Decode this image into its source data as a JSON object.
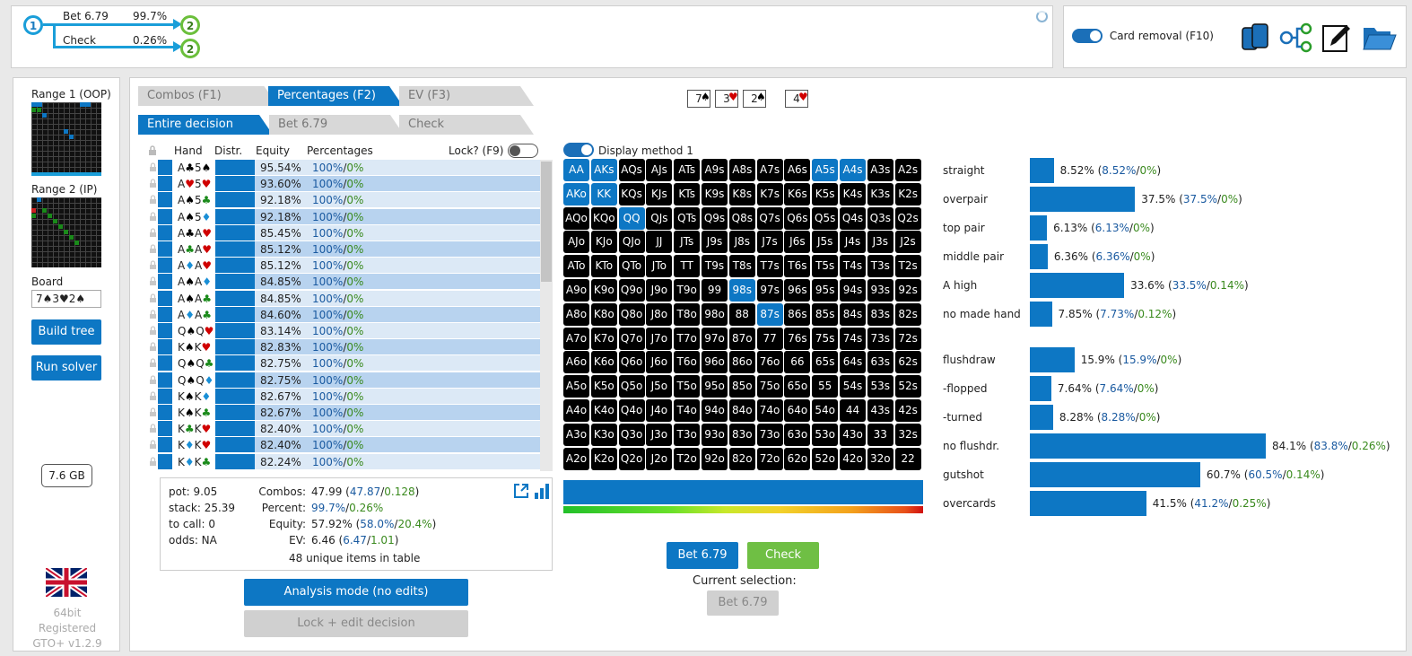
{
  "tree": {
    "root": "1",
    "actions": [
      {
        "label": "Bet 6.79",
        "pct": "99.7%",
        "node": "2"
      },
      {
        "label": "Check",
        "pct": "0.26%",
        "node": "2"
      }
    ]
  },
  "topbar": {
    "card_removal": "Card removal (F10)"
  },
  "sidebar": {
    "range1": "Range 1 (OOP)",
    "range2": "Range 2 (IP)",
    "board_label": "Board",
    "board_value": "7♠3♥2♠",
    "build_tree": "Build tree",
    "run_solver": "Run solver",
    "memory": "7.6 GB",
    "info1": "64bit",
    "info2": "Registered",
    "info3": "GTO+ v1.2.9"
  },
  "tabs": {
    "row1": [
      "Combos (F1)",
      "Percentages (F2)",
      "EV (F3)"
    ],
    "row2": [
      "Entire decision",
      "Bet 6.79",
      "Check"
    ]
  },
  "board_cards": [
    {
      "rank": "7",
      "suit": "♠",
      "color": "#000"
    },
    {
      "rank": "3",
      "suit": "♥",
      "color": "#d00000"
    },
    {
      "rank": "2",
      "suit": "♠",
      "color": "#000"
    },
    {
      "rank": "4",
      "suit": "♥",
      "color": "#d00000"
    }
  ],
  "table": {
    "headers": {
      "hand": "Hand",
      "distr": "Distr.",
      "equity": "Equity",
      "percentages": "Percentages",
      "lock": "Lock? (F9)"
    },
    "rows": [
      {
        "r1": "A",
        "s1": "♣",
        "c1": "#000",
        "r2": "5",
        "s2": "♠",
        "c2": "#000",
        "eq": "95.54%",
        "p1": "100%",
        "p2": "0%"
      },
      {
        "r1": "A",
        "s1": "♥",
        "c1": "#d00000",
        "r2": "5",
        "s2": "♥",
        "c2": "#d00000",
        "eq": "93.60%",
        "p1": "100%",
        "p2": "0%"
      },
      {
        "r1": "A",
        "s1": "♠",
        "c1": "#000",
        "r2": "5",
        "s2": "♣",
        "c2": "#1a8a1a",
        "eq": "92.18%",
        "p1": "100%",
        "p2": "0%"
      },
      {
        "r1": "A",
        "s1": "♠",
        "c1": "#000",
        "r2": "5",
        "s2": "♦",
        "c2": "#1a8fd6",
        "eq": "92.18%",
        "p1": "100%",
        "p2": "0%"
      },
      {
        "r1": "A",
        "s1": "♣",
        "c1": "#000",
        "r2": "A",
        "s2": "♥",
        "c2": "#d00000",
        "eq": "85.45%",
        "p1": "100%",
        "p2": "0%"
      },
      {
        "r1": "A",
        "s1": "♣",
        "c1": "#1a8a1a",
        "r2": "A",
        "s2": "♥",
        "c2": "#d00000",
        "eq": "85.12%",
        "p1": "100%",
        "p2": "0%"
      },
      {
        "r1": "A",
        "s1": "♦",
        "c1": "#1a8fd6",
        "r2": "A",
        "s2": "♥",
        "c2": "#d00000",
        "eq": "85.12%",
        "p1": "100%",
        "p2": "0%"
      },
      {
        "r1": "A",
        "s1": "♠",
        "c1": "#000",
        "r2": "A",
        "s2": "♦",
        "c2": "#1a8fd6",
        "eq": "84.85%",
        "p1": "100%",
        "p2": "0%"
      },
      {
        "r1": "A",
        "s1": "♠",
        "c1": "#000",
        "r2": "A",
        "s2": "♣",
        "c2": "#1a8a1a",
        "eq": "84.85%",
        "p1": "100%",
        "p2": "0%"
      },
      {
        "r1": "A",
        "s1": "♦",
        "c1": "#1a8fd6",
        "r2": "A",
        "s2": "♣",
        "c2": "#1a8a1a",
        "eq": "84.60%",
        "p1": "100%",
        "p2": "0%"
      },
      {
        "r1": "Q",
        "s1": "♠",
        "c1": "#000",
        "r2": "Q",
        "s2": "♥",
        "c2": "#d00000",
        "eq": "83.14%",
        "p1": "100%",
        "p2": "0%"
      },
      {
        "r1": "K",
        "s1": "♠",
        "c1": "#000",
        "r2": "K",
        "s2": "♥",
        "c2": "#d00000",
        "eq": "82.83%",
        "p1": "100%",
        "p2": "0%"
      },
      {
        "r1": "Q",
        "s1": "♠",
        "c1": "#000",
        "r2": "Q",
        "s2": "♣",
        "c2": "#1a8a1a",
        "eq": "82.75%",
        "p1": "100%",
        "p2": "0%"
      },
      {
        "r1": "Q",
        "s1": "♠",
        "c1": "#000",
        "r2": "Q",
        "s2": "♦",
        "c2": "#1a8fd6",
        "eq": "82.75%",
        "p1": "100%",
        "p2": "0%"
      },
      {
        "r1": "K",
        "s1": "♠",
        "c1": "#000",
        "r2": "K",
        "s2": "♦",
        "c2": "#1a8fd6",
        "eq": "82.67%",
        "p1": "100%",
        "p2": "0%"
      },
      {
        "r1": "K",
        "s1": "♠",
        "c1": "#000",
        "r2": "K",
        "s2": "♣",
        "c2": "#1a8a1a",
        "eq": "82.67%",
        "p1": "100%",
        "p2": "0%"
      },
      {
        "r1": "K",
        "s1": "♣",
        "c1": "#1a8a1a",
        "r2": "K",
        "s2": "♥",
        "c2": "#d00000",
        "eq": "82.40%",
        "p1": "100%",
        "p2": "0%"
      },
      {
        "r1": "K",
        "s1": "♦",
        "c1": "#1a8fd6",
        "r2": "K",
        "s2": "♥",
        "c2": "#d00000",
        "eq": "82.40%",
        "p1": "100%",
        "p2": "0%"
      },
      {
        "r1": "K",
        "s1": "♦",
        "c1": "#1a8fd6",
        "r2": "K",
        "s2": "♣",
        "c2": "#1a8a1a",
        "eq": "82.24%",
        "p1": "100%",
        "p2": "0%"
      }
    ]
  },
  "summary": {
    "pot": "pot: 9.05",
    "stack": "stack: 25.39",
    "to_call": "to call: 0",
    "odds": "odds: NA",
    "combos_label": "Combos:",
    "combos_val": "47.99",
    "combos_a": "47.87",
    "combos_b": "0.128",
    "percent_label": "Percent:",
    "percent_a": "99.7%",
    "percent_b": "0.26%",
    "equity_label": "Equity:",
    "equity_val": "57.92%",
    "equity_a": "58.0%",
    "equity_b": "20.4%",
    "ev_label": "EV:",
    "ev_val": "6.46",
    "ev_a": "6.47",
    "ev_b": "1.01",
    "unique": "48 unique items in table"
  },
  "buttons": {
    "analysis": "Analysis mode (no edits)",
    "lock_edit": "Lock + edit decision",
    "bet": "Bet 6.79",
    "check": "Check",
    "current_selection": "Current selection:",
    "current_value": "Bet 6.79"
  },
  "display_method": "Display method 1",
  "matrix": {
    "ranks": [
      "A",
      "K",
      "Q",
      "J",
      "T",
      "9",
      "8",
      "7",
      "6",
      "5",
      "4",
      "3",
      "2"
    ],
    "highlighted": [
      "AA",
      "AKs",
      "A5s",
      "A4s",
      "AKo",
      "KK",
      "QQ",
      "98s",
      "87s"
    ]
  },
  "categories": [
    {
      "label": "straight",
      "value": 8.52,
      "text": "8.52%",
      "a": "8.52%",
      "b": "0%"
    },
    {
      "label": "overpair",
      "value": 37.5,
      "text": "37.5%",
      "a": "37.5%",
      "b": "0%"
    },
    {
      "label": "top pair",
      "value": 6.13,
      "text": "6.13%",
      "a": "6.13%",
      "b": "0%"
    },
    {
      "label": "middle pair",
      "value": 6.36,
      "text": "6.36%",
      "a": "6.36%",
      "b": "0%"
    },
    {
      "label": "A high",
      "value": 33.6,
      "text": "33.6%",
      "a": "33.5%",
      "b": "0.14%"
    },
    {
      "label": "no made hand",
      "value": 7.85,
      "text": "7.85%",
      "a": "7.73%",
      "b": "0.12%"
    },
    {
      "label": "flushdraw",
      "value": 15.9,
      "text": "15.9%",
      "a": "15.9%",
      "b": "0%"
    },
    {
      "label": "-flopped",
      "value": 7.64,
      "text": "7.64%",
      "a": "7.64%",
      "b": "0%"
    },
    {
      "label": "-turned",
      "value": 8.28,
      "text": "8.28%",
      "a": "8.28%",
      "b": "0%"
    },
    {
      "label": "no flushdr.",
      "value": 84.1,
      "text": "84.1%",
      "a": "83.8%",
      "b": "0.26%"
    },
    {
      "label": "gutshot",
      "value": 60.7,
      "text": "60.7%",
      "a": "60.5%",
      "b": "0.14%"
    },
    {
      "label": "overcards",
      "value": 41.5,
      "text": "41.5%",
      "a": "41.2%",
      "b": "0.25%"
    }
  ]
}
